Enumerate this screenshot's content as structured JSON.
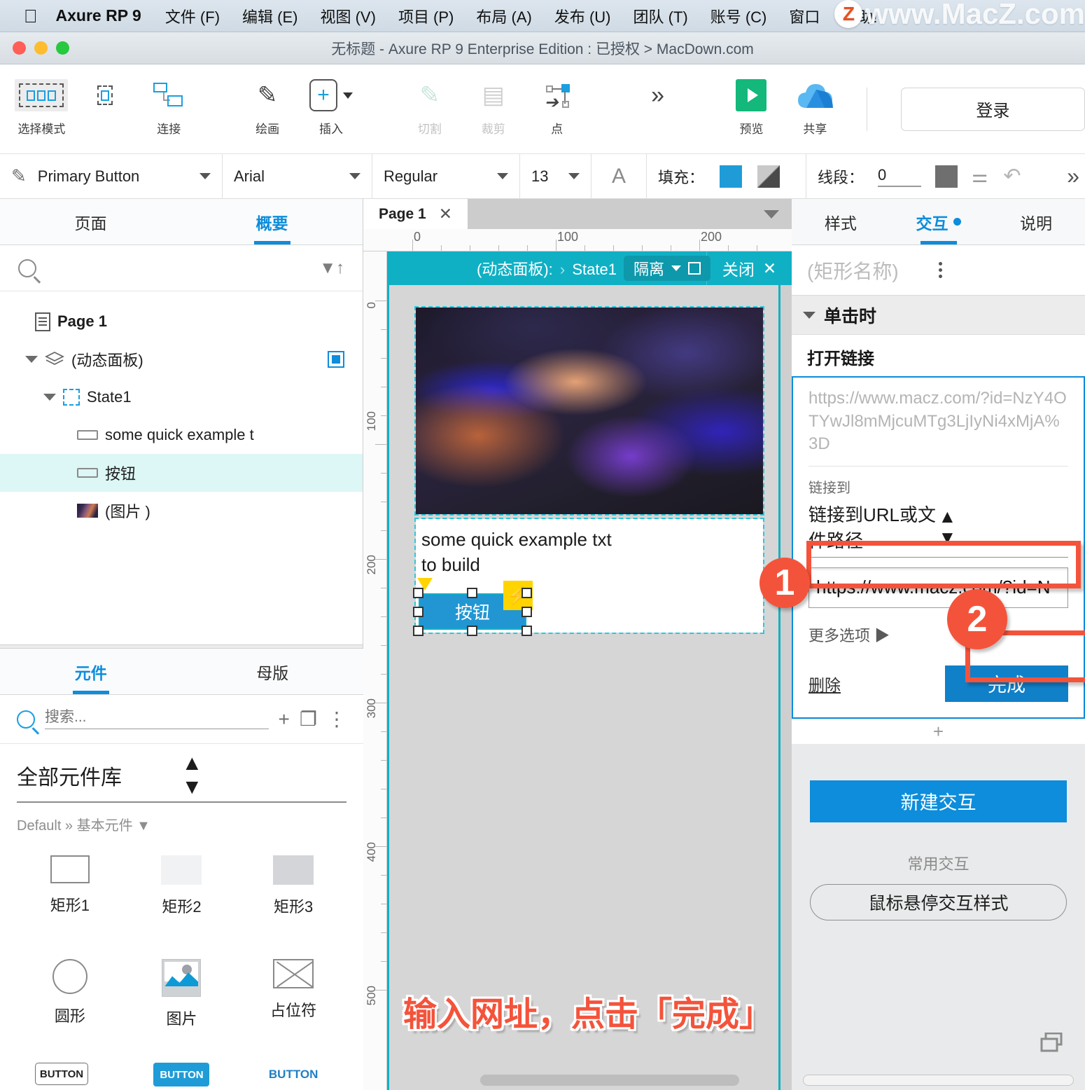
{
  "menubar": {
    "app_name": "Axure RP 9",
    "apple_icon": "apple-logo-icon",
    "items": [
      "文件 (F)",
      "编辑 (E)",
      "视图 (V)",
      "项目 (P)",
      "布局 (A)",
      "发布 (U)",
      "团队 (T)",
      "账号 (C)",
      "窗口",
      "帮助!"
    ],
    "watermark": "www.MacZ.com",
    "watermark_badge": "Z"
  },
  "titlebar": {
    "title": "无标题 - Axure RP 9 Enterprise Edition : 已授权 > MacDown.com"
  },
  "toolbar": {
    "items": [
      {
        "label": "选择模式",
        "icon": "select-mode-icon",
        "disabled": false
      },
      {
        "label": "连接",
        "icon": "connect-icon",
        "disabled": false
      },
      {
        "label": "绘画",
        "icon": "pen-draw-icon",
        "disabled": false
      },
      {
        "label": "插入",
        "icon": "insert-plus-icon",
        "disabled": false
      },
      {
        "label": "切割",
        "icon": "cut-icon",
        "disabled": true
      },
      {
        "label": "裁剪",
        "icon": "crop-icon",
        "disabled": true
      },
      {
        "label": "点",
        "icon": "point-icon",
        "disabled": false
      },
      {
        "label": "预览",
        "icon": "preview-play-icon",
        "disabled": false
      },
      {
        "label": "共享",
        "icon": "share-cloud-icon",
        "disabled": false
      }
    ],
    "overflow_icon": "chevron-double-right-icon",
    "login_label": "登录"
  },
  "formatbar": {
    "style_name": "Primary Button",
    "font_family": "Arial",
    "font_weight": "Regular",
    "font_size": "13",
    "text_color_icon": "A",
    "fill_label": "填充：",
    "fill_color": "#1f9cd8",
    "line_label": "线段：",
    "line_width": "0",
    "line_color": "#6f6f6f",
    "overflow_icon": "chevron-double-right-icon"
  },
  "left_panel": {
    "tabs": [
      {
        "label": "页面",
        "active": false
      },
      {
        "label": "概要",
        "active": true
      }
    ],
    "search_placeholder": "",
    "search_icon": "search-icon",
    "filter_icon": "filter-sort-icon",
    "tree": [
      {
        "label": "Page 1",
        "icon": "page-doc-icon",
        "depth": 0,
        "expander": "none",
        "bold": true,
        "selected": false
      },
      {
        "label": "(动态面板)",
        "icon": "layers-icon",
        "depth": 1,
        "expander": "down",
        "bold": false,
        "selected": false,
        "badge": true
      },
      {
        "label": "State1",
        "icon": "state-dashed-icon",
        "depth": 2,
        "expander": "down",
        "bold": false,
        "selected": false
      },
      {
        "label": "some quick example t",
        "icon": "shape-rect-icon",
        "depth": 3,
        "expander": "none",
        "bold": false,
        "selected": false
      },
      {
        "label": "按钮",
        "icon": "shape-rect-icon",
        "depth": 3,
        "expander": "none",
        "bold": false,
        "selected": true
      },
      {
        "label": "(图片 )",
        "icon": "image-thumb-icon",
        "depth": 3,
        "expander": "none",
        "bold": false,
        "selected": false
      }
    ],
    "library": {
      "tabs": [
        {
          "label": "元件",
          "active": true
        },
        {
          "label": "母版",
          "active": false
        }
      ],
      "search_placeholder": "搜索...",
      "add_icon": "plus-icon",
      "duplicate_icon": "duplicate-icon",
      "more_icon": "kebab-menu-icon",
      "selected_library": "全部元件库",
      "breadcrumb": "Default » 基本元件 ▼",
      "widgets": [
        {
          "label": "矩形1",
          "shape": "rect1"
        },
        {
          "label": "矩形2",
          "shape": "rect2"
        },
        {
          "label": "矩形3",
          "shape": "rect3"
        },
        {
          "label": "圆形",
          "shape": "circle"
        },
        {
          "label": "图片",
          "shape": "image"
        },
        {
          "label": "占位符",
          "shape": "placeholder"
        },
        {
          "label": "",
          "shape": "button-outline",
          "button_text": "BUTTON"
        },
        {
          "label": "",
          "shape": "button-filled",
          "button_text": "BUTTON"
        },
        {
          "label": "",
          "shape": "button-text",
          "button_text": "BUTTON"
        }
      ]
    }
  },
  "canvas": {
    "tab_label": "Page 1",
    "tab_close_icon": "close-icon",
    "tabs_dropdown_icon": "chevron-down-icon",
    "origin_icon": "ruler-origin-icon",
    "ruler_h": [
      "0",
      "100",
      "200"
    ],
    "ruler_v": [
      "0",
      "100",
      "200",
      "300",
      "400",
      "500"
    ],
    "ribbon": {
      "prefix": "(动态面板):",
      "separator": "›",
      "state": "State1",
      "isolate_label": "隔离",
      "isolate_caret_icon": "chevron-down-icon",
      "isolate_frame_icon": "focus-frame-icon",
      "close_label": "关闭",
      "close_icon": "close-icon"
    },
    "text_widget": "some quick example txt\nto build",
    "button_widget": "按钮",
    "image_widget_alt": "abstract-gradient-image",
    "bolt_icon": "interaction-bolt-icon",
    "annotation_tri_icon": "annotation-triangle-icon",
    "red_caption": "输入网址，点击「完成」"
  },
  "right_panel": {
    "tabs": [
      {
        "label": "样式",
        "active": false,
        "dot": false
      },
      {
        "label": "交互",
        "active": true,
        "dot": true
      },
      {
        "label": "说明",
        "active": false,
        "dot": false
      }
    ],
    "widget_name_placeholder": "(矩形名称)",
    "more_icon": "kebab-menu-icon",
    "event": {
      "name": "单击时",
      "expander_icon": "chevron-down-icon"
    },
    "action": {
      "name": "打开链接",
      "ghost_url": "https://www.macz.com/?id=NzY4OTYwJl8mMjcuMTg3LjIyNi4xMjA%3D",
      "link_to_label": "链接到",
      "link_to_value": "链接到URL或文件路径",
      "link_to_stepper_icon": "stepper-updown-icon",
      "url_input_value": "https://www.macz.com/?id=N",
      "more_options_label": "更多选项 ▶",
      "delete_label": "删除",
      "done_label": "完成"
    },
    "add_action_icon": "plus-icon",
    "new_interaction_label": "新建交互",
    "common_interactions_label": "常用交互",
    "hover_style_label": "鼠标悬停交互样式",
    "duplicate_icon": "duplicate-icon"
  },
  "annotations": {
    "badge_one": "1",
    "badge_two": "2",
    "accent_red": "#f4533b",
    "accent_blue": "#0d8ddb",
    "accent_teal": "#10b0c4"
  }
}
